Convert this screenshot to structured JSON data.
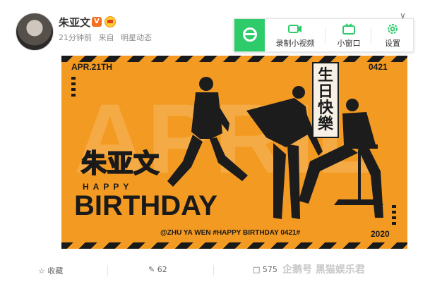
{
  "post": {
    "username": "朱亚文",
    "verified_badge": "V",
    "time": "21分钟前",
    "source_prefix": "来自",
    "source": "明星动态"
  },
  "toolbar": {
    "record_label": "录制小视频",
    "mini_label": "小窗口",
    "settings_label": "设置"
  },
  "image": {
    "apr": "APR.21TH",
    "code": "0421",
    "big_text": "APRIL",
    "name": "朱亚文",
    "happy": "HAPPY",
    "birthday": "BIRTHDAY",
    "greeting": "生日快樂",
    "tag": "@ZHU YA WEN #HAPPY BIRTHDAY 0421#",
    "year": "2020"
  },
  "actions": {
    "favorite_label": "收藏",
    "repost_count": "62",
    "comment_count": "575"
  },
  "watermark": "企鹅号 黑猫娱乐君",
  "colors": {
    "accent": "#f36e25",
    "banner": "#f39a22",
    "toolbar_green": "#2dcb6a"
  }
}
